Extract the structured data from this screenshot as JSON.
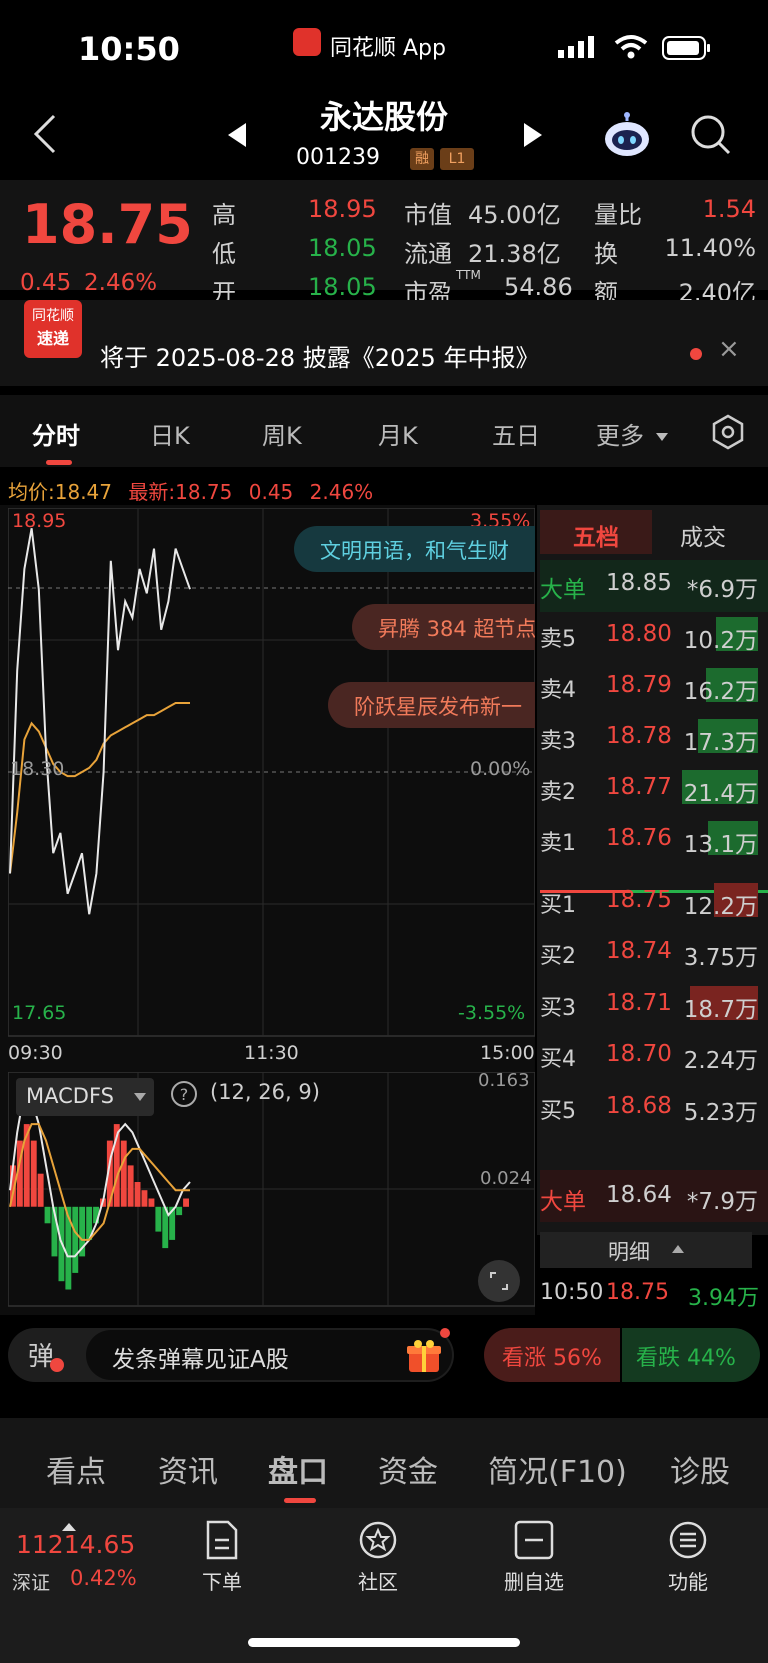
{
  "status": {
    "time": "10:50",
    "app_name": "同花顺 App",
    "app_badge": "同花顺"
  },
  "header": {
    "title": "永达股份",
    "code": "001239",
    "tag_rong": "融",
    "tag_level": "L1"
  },
  "quote": {
    "price": "18.75",
    "change": "0.45",
    "change_pct": "2.46%",
    "high_label": "高",
    "high": "18.95",
    "low_label": "低",
    "low": "18.05",
    "open_label": "开",
    "open": "18.05",
    "mktcap_label": "市值",
    "mktcap": "45.00亿",
    "float_label": "流通",
    "float": "21.38亿",
    "pe_label": "市盈",
    "pe_sup": "TTM",
    "pe": "54.86",
    "volratio_label": "量比",
    "volratio": "1.54",
    "turnover_label": "换",
    "turnover": "11.40%",
    "amount_label": "额",
    "amount": "2.40亿"
  },
  "news": {
    "badge_top": "同花顺",
    "badge_bottom": "速递",
    "text": "将于 2025-08-28 披露《2025 年中报》",
    "close": "×"
  },
  "tabs": [
    "分时",
    "日K",
    "周K",
    "月K",
    "五日",
    "更多"
  ],
  "info_line": {
    "avg_label": "均价:",
    "avg": "18.47",
    "latest_label": "最新:",
    "latest": "18.75",
    "chg": "0.45",
    "pct": "2.46%"
  },
  "chart": {
    "y_top": "18.95",
    "y_mid": "18.30",
    "y_bot": "17.65",
    "pct_top": "3.55%",
    "pct_mid": "0.00%",
    "pct_bot": "-3.55%",
    "x_labels": [
      "09:30",
      "11:30",
      "15:00"
    ],
    "pills": [
      "文明用语，和气生财",
      "昇腾 384 超节点",
      "阶跃星辰发布新一"
    ],
    "indicator": "MACDFS",
    "params": "(12, 26, 9)",
    "macd_top": "0.163",
    "macd_mid": "0.024",
    "colors": {
      "price": "#e8e8e8",
      "avg": "#e8a33a",
      "up": "#f0473f",
      "down": "#27b24a"
    }
  },
  "chart_data": {
    "type": "line",
    "title": "",
    "xlabel": "",
    "ylabel": "",
    "ylim": [
      17.65,
      18.95
    ],
    "x_range": [
      "09:30",
      "15:00"
    ],
    "series": [
      {
        "values": [
          18.05,
          18.55,
          18.8,
          18.9,
          18.75,
          18.35,
          18.1,
          18.15,
          18.0,
          18.05,
          18.1,
          17.95,
          18.05,
          18.3,
          18.82,
          18.6,
          18.72,
          18.68,
          18.8,
          18.74,
          18.85,
          18.65,
          18.72,
          18.85,
          18.8,
          18.75
        ]
      },
      {
        "values": [
          18.05,
          18.2,
          18.38,
          18.42,
          18.4,
          18.36,
          18.32,
          18.3,
          18.29,
          18.29,
          18.3,
          18.31,
          18.33,
          18.37,
          18.39,
          18.4,
          18.41,
          18.42,
          18.43,
          18.44,
          18.44,
          18.45,
          18.46,
          18.47,
          18.47,
          18.47
        ]
      }
    ],
    "macd": {
      "ylim": [
        -0.12,
        0.163
      ],
      "hist": [
        0.05,
        0.08,
        0.1,
        0.08,
        0.04,
        -0.02,
        -0.06,
        -0.09,
        -0.1,
        -0.08,
        -0.06,
        -0.04,
        -0.02,
        0.01,
        0.08,
        0.1,
        0.08,
        0.05,
        0.03,
        0.02,
        0.01,
        -0.03,
        -0.05,
        -0.04,
        -0.01,
        0.01
      ],
      "dif": [
        0.02,
        0.09,
        0.14,
        0.13,
        0.1,
        0.05,
        0.0,
        -0.04,
        -0.06,
        -0.06,
        -0.05,
        -0.04,
        -0.02,
        0.01,
        0.06,
        0.09,
        0.1,
        0.09,
        0.07,
        0.05,
        0.03,
        0.01,
        -0.01,
        0.0,
        0.02,
        0.03
      ],
      "dea": [
        0.0,
        0.04,
        0.08,
        0.1,
        0.1,
        0.08,
        0.05,
        0.02,
        -0.01,
        -0.03,
        -0.04,
        -0.04,
        -0.03,
        -0.02,
        0.01,
        0.04,
        0.06,
        0.07,
        0.07,
        0.06,
        0.05,
        0.04,
        0.03,
        0.02,
        0.02,
        0.02
      ]
    }
  },
  "orderbook": {
    "tab_active": "五档",
    "tab_other": "成交",
    "big_sell": {
      "label": "大单",
      "price": "18.85",
      "vol": "*6.9万"
    },
    "asks": [
      {
        "label": "卖5",
        "price": "18.80",
        "vol": "10.2万"
      },
      {
        "label": "卖4",
        "price": "18.79",
        "vol": "16.2万"
      },
      {
        "label": "卖3",
        "price": "18.78",
        "vol": "17.3万"
      },
      {
        "label": "卖2",
        "price": "18.77",
        "vol": "21.4万"
      },
      {
        "label": "卖1",
        "price": "18.76",
        "vol": "13.1万"
      }
    ],
    "bids": [
      {
        "label": "买1",
        "price": "18.75",
        "vol": "12.2万"
      },
      {
        "label": "买2",
        "price": "18.74",
        "vol": "3.75万"
      },
      {
        "label": "买3",
        "price": "18.71",
        "vol": "18.7万"
      },
      {
        "label": "买4",
        "price": "18.70",
        "vol": "2.24万"
      },
      {
        "label": "买5",
        "price": "18.68",
        "vol": "5.23万"
      }
    ],
    "big_buy": {
      "label": "大单",
      "price": "18.64",
      "vol": "*7.9万"
    },
    "detail_label": "明细",
    "trade": {
      "time": "10:50",
      "price": "18.75",
      "vol": "3.94万"
    }
  },
  "danmu": {
    "icon": "弹",
    "placeholder": "发条弹幕见证A股",
    "up": "看涨 56%",
    "down": "看跌 44%"
  },
  "bottom_tabs": [
    "看点",
    "资讯",
    "盘口",
    "资金",
    "简况(F10)",
    "诊股"
  ],
  "toolbar": {
    "index_value": "11214.65",
    "index_name": "深证",
    "index_pct": "0.42%",
    "order": "下单",
    "community": "社区",
    "remove": "删自选",
    "func": "功能"
  }
}
